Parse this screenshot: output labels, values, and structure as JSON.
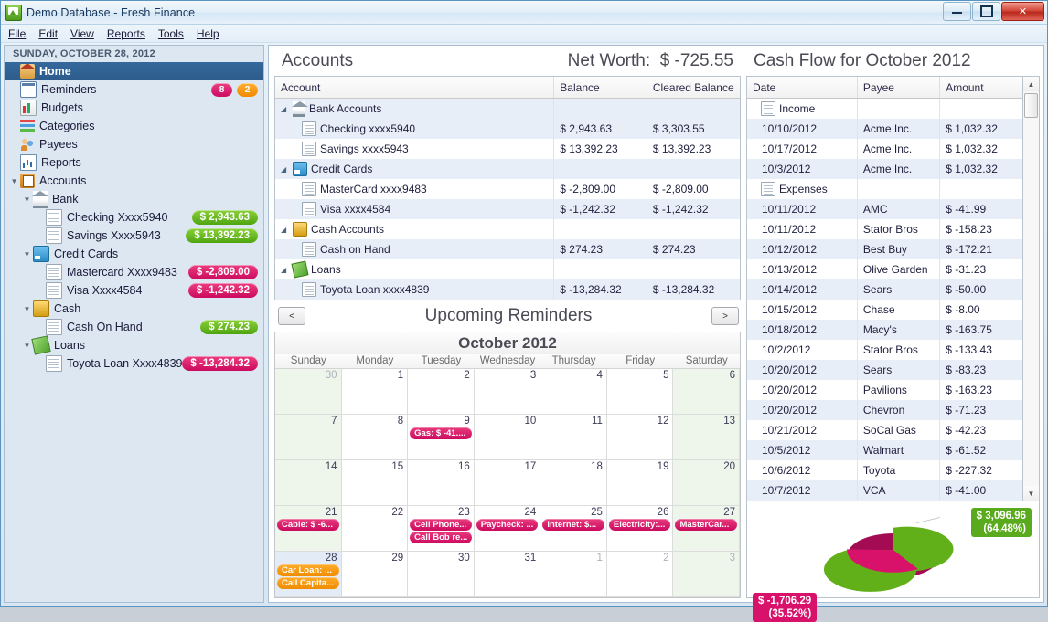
{
  "window": {
    "title": "Demo Database - Fresh Finance",
    "icon": "app-icon",
    "minimize": "–",
    "maximize": "□",
    "close": "✕"
  },
  "menu": [
    "File",
    "Edit",
    "View",
    "Reports",
    "Tools",
    "Help"
  ],
  "sidebar": {
    "date_header": "SUNDAY, OCTOBER 28, 2012",
    "items": [
      {
        "label": "Home",
        "icon": "home-icon",
        "selected": true,
        "indent": 0
      },
      {
        "label": "Reminders",
        "icon": "calendar-icon",
        "badges": [
          {
            "value": "8",
            "color": "#cc0a63"
          },
          {
            "value": "2",
            "color": "#f08a00"
          }
        ],
        "indent": 0
      },
      {
        "label": "Budgets",
        "icon": "bar-chart-icon",
        "indent": 0
      },
      {
        "label": "Categories",
        "icon": "categories-icon",
        "indent": 0
      },
      {
        "label": "Payees",
        "icon": "payees-icon",
        "indent": 0
      },
      {
        "label": "Reports",
        "icon": "reports-icon",
        "indent": 0
      },
      {
        "label": "Accounts",
        "icon": "accounts-icon",
        "twisty": "▼",
        "indent": 0
      },
      {
        "label": "Bank",
        "icon": "bank-icon",
        "twisty": "▼",
        "indent": 1
      },
      {
        "label": "Checking Xxxx5940",
        "icon": "document-icon",
        "amount": "$ 2,943.63",
        "sign": "pos",
        "indent": 2
      },
      {
        "label": "Savings Xxxx5943",
        "icon": "document-icon",
        "amount": "$ 13,392.23",
        "sign": "pos",
        "indent": 2
      },
      {
        "label": "Credit Cards",
        "icon": "credit-card-icon",
        "twisty": "▼",
        "indent": 1
      },
      {
        "label": "Mastercard Xxxx9483",
        "icon": "document-icon",
        "amount": "$ -2,809.00",
        "sign": "neg",
        "indent": 2
      },
      {
        "label": "Visa Xxxx4584",
        "icon": "document-icon",
        "amount": "$ -1,242.32",
        "sign": "neg",
        "indent": 2
      },
      {
        "label": "Cash",
        "icon": "cash-icon",
        "twisty": "▼",
        "indent": 1
      },
      {
        "label": "Cash On Hand",
        "icon": "document-icon",
        "amount": "$ 274.23",
        "sign": "pos",
        "indent": 2
      },
      {
        "label": "Loans",
        "icon": "loan-icon",
        "twisty": "▼",
        "indent": 1
      },
      {
        "label": "Toyota Loan Xxxx4839",
        "icon": "document-icon",
        "amount": "$ -13,284.32",
        "sign": "neg",
        "indent": 2
      }
    ]
  },
  "accounts_panel": {
    "title": "Accounts",
    "net_worth_label": "Net Worth:",
    "net_worth_value": "$ -725.55",
    "columns": [
      "Account",
      "Balance",
      "Cleared Balance"
    ],
    "rows": [
      {
        "twisty": "◢",
        "icon": "bank-icon",
        "name": "Bank Accounts",
        "balance": "",
        "cleared": "",
        "group": true,
        "alt": true
      },
      {
        "icon": "document-icon",
        "name": "Checking xxxx5940",
        "balance": "$ 2,943.63",
        "cleared": "$ 3,303.55",
        "group": false,
        "alt": true
      },
      {
        "icon": "document-icon",
        "name": "Savings xxxx5943",
        "balance": "$ 13,392.23",
        "cleared": "$ 13,392.23",
        "group": false,
        "alt": false
      },
      {
        "twisty": "◢",
        "icon": "credit-card-icon",
        "name": "Credit Cards",
        "balance": "",
        "cleared": "",
        "group": true,
        "alt": true
      },
      {
        "icon": "document-icon",
        "name": "MasterCard xxxx9483",
        "balance": "$ -2,809.00",
        "cleared": "$ -2,809.00",
        "group": false,
        "alt": false
      },
      {
        "icon": "document-icon",
        "name": "Visa xxxx4584",
        "balance": "$ -1,242.32",
        "cleared": "$ -1,242.32",
        "group": false,
        "alt": true
      },
      {
        "twisty": "◢",
        "icon": "cash-icon",
        "name": "Cash Accounts",
        "balance": "",
        "cleared": "",
        "group": true,
        "alt": false
      },
      {
        "icon": "document-icon",
        "name": "Cash on Hand",
        "balance": "$ 274.23",
        "cleared": "$ 274.23",
        "group": false,
        "alt": true
      },
      {
        "twisty": "◢",
        "icon": "loan-icon",
        "name": "Loans",
        "balance": "",
        "cleared": "",
        "group": true,
        "alt": false
      },
      {
        "icon": "document-icon",
        "name": "Toyota Loan xxxx4839",
        "balance": "$ -13,284.32",
        "cleared": "$ -13,284.32",
        "group": false,
        "alt": true
      }
    ]
  },
  "reminders_panel": {
    "title": "Upcoming Reminders",
    "prev_label": "<",
    "next_label": ">",
    "month_title": "October 2012",
    "day_names": [
      "Sunday",
      "Monday",
      "Tuesday",
      "Wednesday",
      "Thursday",
      "Friday",
      "Saturday"
    ],
    "weeks": [
      [
        {
          "num": "30",
          "outside": true,
          "weekend": true,
          "events": []
        },
        {
          "num": "1",
          "events": []
        },
        {
          "num": "2",
          "events": []
        },
        {
          "num": "3",
          "events": []
        },
        {
          "num": "4",
          "events": []
        },
        {
          "num": "5",
          "events": []
        },
        {
          "num": "6",
          "weekend": true,
          "events": []
        }
      ],
      [
        {
          "num": "7",
          "weekend": true,
          "events": []
        },
        {
          "num": "8",
          "events": []
        },
        {
          "num": "9",
          "events": [
            {
              "text": "Gas: $ -41....",
              "color": "pink"
            }
          ]
        },
        {
          "num": "10",
          "events": []
        },
        {
          "num": "11",
          "events": []
        },
        {
          "num": "12",
          "events": []
        },
        {
          "num": "13",
          "weekend": true,
          "events": []
        }
      ],
      [
        {
          "num": "14",
          "weekend": true,
          "events": []
        },
        {
          "num": "15",
          "events": []
        },
        {
          "num": "16",
          "events": []
        },
        {
          "num": "17",
          "events": []
        },
        {
          "num": "18",
          "events": []
        },
        {
          "num": "19",
          "events": []
        },
        {
          "num": "20",
          "weekend": true,
          "events": []
        }
      ],
      [
        {
          "num": "21",
          "weekend": true,
          "events": [
            {
              "text": "Cable: $ -6...",
              "color": "pink"
            }
          ]
        },
        {
          "num": "22",
          "events": []
        },
        {
          "num": "23",
          "events": [
            {
              "text": "Cell Phone...",
              "color": "pink"
            },
            {
              "text": "Call Bob re...",
              "color": "pink"
            }
          ]
        },
        {
          "num": "24",
          "events": [
            {
              "text": "Paycheck: ...",
              "color": "pink"
            }
          ]
        },
        {
          "num": "25",
          "events": [
            {
              "text": "Internet: $...",
              "color": "pink"
            }
          ]
        },
        {
          "num": "26",
          "events": [
            {
              "text": "Electricity:...",
              "color": "pink"
            }
          ]
        },
        {
          "num": "27",
          "weekend": true,
          "events": [
            {
              "text": "MasterCar...",
              "color": "pink"
            }
          ]
        }
      ],
      [
        {
          "num": "28",
          "weekend": true,
          "today": true,
          "events": [
            {
              "text": "Car Loan: ...",
              "color": "orange"
            },
            {
              "text": "Call Capita...",
              "color": "orange"
            }
          ]
        },
        {
          "num": "29",
          "events": []
        },
        {
          "num": "30",
          "events": []
        },
        {
          "num": "31",
          "events": []
        },
        {
          "num": "1",
          "outside": true,
          "events": []
        },
        {
          "num": "2",
          "outside": true,
          "events": []
        },
        {
          "num": "3",
          "outside": true,
          "weekend": true,
          "events": []
        }
      ]
    ]
  },
  "cashflow_panel": {
    "title": "Cash Flow for October 2012",
    "columns": [
      "Date",
      "Payee",
      "Amount"
    ],
    "rows": [
      {
        "date": "Income",
        "payee": "",
        "amount": "",
        "group": true,
        "alt": false
      },
      {
        "date": "10/10/2012",
        "payee": "Acme Inc.",
        "amount": "$ 1,032.32",
        "alt": true
      },
      {
        "date": "10/17/2012",
        "payee": "Acme Inc.",
        "amount": "$ 1,032.32",
        "alt": false
      },
      {
        "date": "10/3/2012",
        "payee": "Acme Inc.",
        "amount": "$ 1,032.32",
        "alt": true
      },
      {
        "date": "Expenses",
        "payee": "",
        "amount": "",
        "group": true,
        "alt": false
      },
      {
        "date": "10/11/2012",
        "payee": "AMC",
        "amount": "$ -41.99",
        "alt": true
      },
      {
        "date": "10/11/2012",
        "payee": "Stator Bros",
        "amount": "$ -158.23",
        "alt": false
      },
      {
        "date": "10/12/2012",
        "payee": "Best Buy",
        "amount": "$ -172.21",
        "alt": true
      },
      {
        "date": "10/13/2012",
        "payee": "Olive Garden",
        "amount": "$ -31.23",
        "alt": false
      },
      {
        "date": "10/14/2012",
        "payee": "Sears",
        "amount": "$ -50.00",
        "alt": true
      },
      {
        "date": "10/15/2012",
        "payee": "Chase",
        "amount": "$ -8.00",
        "alt": false
      },
      {
        "date": "10/18/2012",
        "payee": "Macy's",
        "amount": "$ -163.75",
        "alt": true
      },
      {
        "date": "10/2/2012",
        "payee": "Stator Bros",
        "amount": "$ -133.43",
        "alt": false
      },
      {
        "date": "10/20/2012",
        "payee": "Sears",
        "amount": "$ -83.23",
        "alt": true
      },
      {
        "date": "10/20/2012",
        "payee": "Pavilions",
        "amount": "$ -163.23",
        "alt": false
      },
      {
        "date": "10/20/2012",
        "payee": "Chevron",
        "amount": "$ -71.23",
        "alt": true
      },
      {
        "date": "10/21/2012",
        "payee": "SoCal Gas",
        "amount": "$ -42.23",
        "alt": false
      },
      {
        "date": "10/5/2012",
        "payee": "Walmart",
        "amount": "$ -61.52",
        "alt": true
      },
      {
        "date": "10/6/2012",
        "payee": "Toyota",
        "amount": "$ -227.32",
        "alt": false
      },
      {
        "date": "10/7/2012",
        "payee": "VCA",
        "amount": "$ -41.00",
        "alt": true
      }
    ],
    "scroll_up": "▲",
    "scroll_down": "▼"
  },
  "chart_data": {
    "type": "pie",
    "title": "",
    "labels": [
      "Income",
      "Expenses"
    ],
    "values": [
      3096.96,
      1706.29
    ],
    "percentages": [
      64.48,
      35.52
    ],
    "colors": [
      "#5aaa1e",
      "#d8116b"
    ],
    "annotations": [
      {
        "text": "$ 3,096.96\n(64.48%)",
        "color": "#5aaa1e",
        "slice": "Income"
      },
      {
        "text": "$ -1,706.29\n(35.52%)",
        "color": "#d8116b",
        "slice": "Expenses"
      }
    ],
    "legend": "none",
    "grid": false
  }
}
